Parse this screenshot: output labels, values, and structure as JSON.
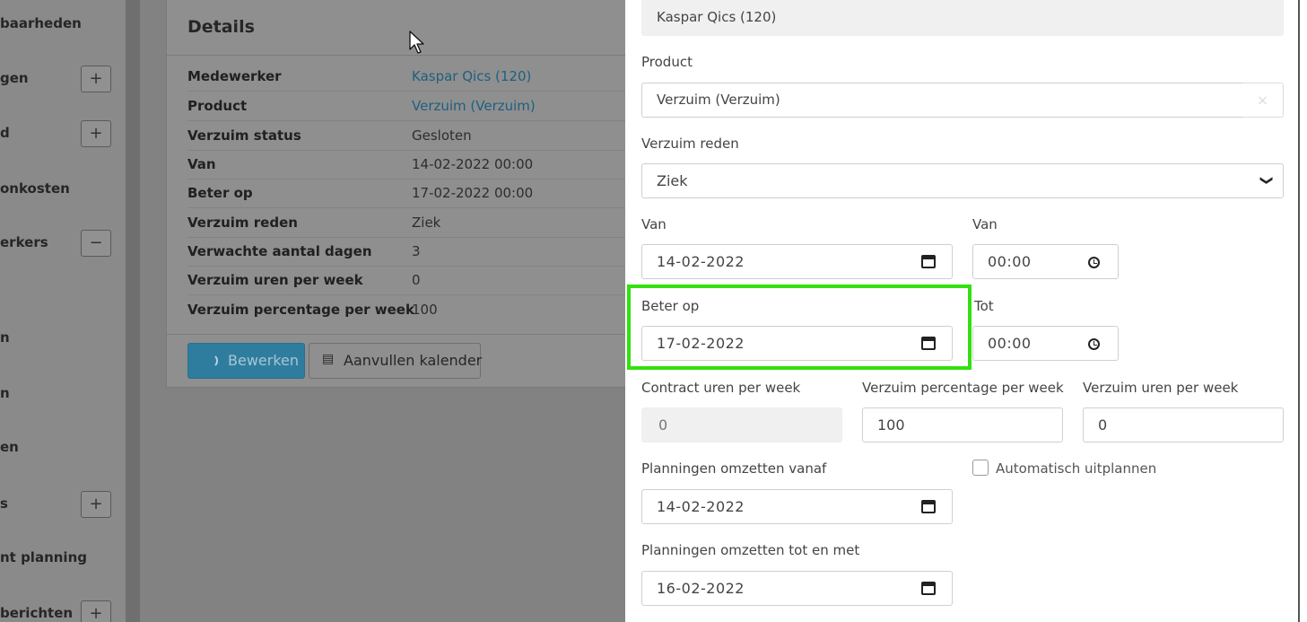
{
  "sidebar": {
    "items": [
      {
        "label": "baarheden",
        "toggle": ""
      },
      {
        "label": "gen",
        "toggle": "+"
      },
      {
        "label": "d",
        "toggle": "+"
      },
      {
        "label": "onkosten",
        "toggle": ""
      },
      {
        "label": "erkers",
        "toggle": "−"
      },
      {
        "label": "n",
        "toggle": ""
      },
      {
        "label": "n",
        "toggle": ""
      },
      {
        "label": "en",
        "toggle": ""
      },
      {
        "label": "s",
        "toggle": "+"
      },
      {
        "label": "nt planning",
        "toggle": ""
      },
      {
        "label": "berichten",
        "toggle": "+"
      }
    ]
  },
  "details": {
    "title": "Details",
    "rows": [
      {
        "key": "Medewerker",
        "value": "Kaspar Qics (120)"
      },
      {
        "key": "Product",
        "value": "Verzuim (Verzuim)"
      },
      {
        "key": "Verzuim status",
        "value": "Gesloten"
      },
      {
        "key": "Van",
        "value": "14-02-2022 00:00"
      },
      {
        "key": "Beter op",
        "value": "17-02-2022 00:00"
      },
      {
        "key": "Verzuim reden",
        "value": "Ziek"
      },
      {
        "key": "Verwachte aantal dagen",
        "value": "3"
      },
      {
        "key": "Verzuim uren per week",
        "value": "0"
      },
      {
        "key": "Verzuim percentage per week",
        "value": "100"
      }
    ],
    "edit_label": "Bewerken",
    "calendar_label": "Aanvullen kalender",
    "calendar_icon": "▤"
  },
  "form": {
    "employee_value": "Kaspar Qics (120)",
    "product_label": "Product",
    "product_value": "Verzuim (Verzuim)",
    "product_clear": "×",
    "reason_label": "Verzuim reden",
    "reason_value": "Ziek",
    "reason_chevron": "❯",
    "from_date_label": "Van",
    "from_date_value": "14-02-2022",
    "from_time_label": "Van",
    "from_time_value": "00:00",
    "better_date_label": "Beter op",
    "better_date_value": "17-02-2022",
    "to_time_label": "Tot",
    "to_time_value": "00:00",
    "contract_hours_label": "Contract uren per week",
    "contract_hours_value": "0",
    "absence_pct_label": "Verzuim percentage per week",
    "absence_pct_value": "100",
    "absence_hours_label": "Verzuim uren per week",
    "absence_hours_value": "0",
    "plan_from_label": "Planningen omzetten vanaf",
    "plan_from_value": "14-02-2022",
    "auto_unplan_label": "Automatisch uitplannen",
    "plan_to_label": "Planningen omzetten tot en met",
    "plan_to_value": "16-02-2022"
  },
  "colors": {
    "highlight": "#33e00f",
    "link": "#1f5f80",
    "primary_button": "#2e7d9e"
  }
}
